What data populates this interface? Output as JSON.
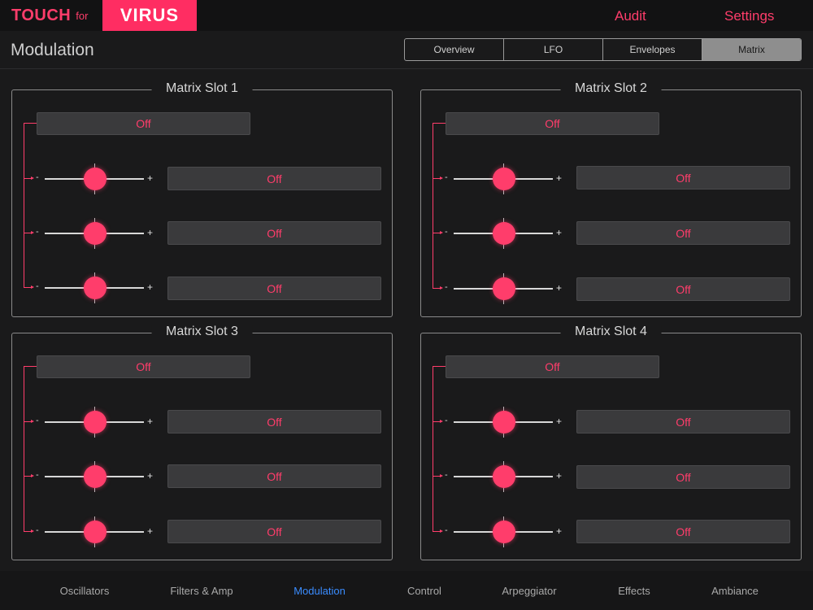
{
  "brand": {
    "touch": "TOUCH",
    "for": "for",
    "virus": "VIRUS"
  },
  "top_links": {
    "audit": "Audit",
    "settings": "Settings"
  },
  "header": {
    "title": "Modulation"
  },
  "tabs": [
    {
      "label": "Overview",
      "active": false
    },
    {
      "label": "LFO",
      "active": false
    },
    {
      "label": "Envelopes",
      "active": false
    },
    {
      "label": "Matrix",
      "active": true
    }
  ],
  "slots": [
    {
      "title": "Matrix Slot 1",
      "source": "Off",
      "rows": [
        {
          "minus": "-",
          "plus": "+",
          "destination": "Off"
        },
        {
          "minus": "-",
          "plus": "+",
          "destination": "Off"
        },
        {
          "minus": "-",
          "plus": "+",
          "destination": "Off"
        }
      ]
    },
    {
      "title": "Matrix Slot 2",
      "source": "Off",
      "rows": [
        {
          "minus": "-",
          "plus": "+",
          "destination": "Off"
        },
        {
          "minus": "-",
          "plus": "+",
          "destination": "Off"
        },
        {
          "minus": "-",
          "plus": "+",
          "destination": "Off"
        }
      ]
    },
    {
      "title": "Matrix Slot 3",
      "source": "Off",
      "rows": [
        {
          "minus": "-",
          "plus": "+",
          "destination": "Off"
        },
        {
          "minus": "-",
          "plus": "+",
          "destination": "Off"
        },
        {
          "minus": "-",
          "plus": "+",
          "destination": "Off"
        }
      ]
    },
    {
      "title": "Matrix Slot 4",
      "source": "Off",
      "rows": [
        {
          "minus": "-",
          "plus": "+",
          "destination": "Off"
        },
        {
          "minus": "-",
          "plus": "+",
          "destination": "Off"
        },
        {
          "minus": "-",
          "plus": "+",
          "destination": "Off"
        }
      ]
    }
  ],
  "bottom_nav": [
    {
      "label": "Oscillators",
      "active": false
    },
    {
      "label": "Filters & Amp",
      "active": false
    },
    {
      "label": "Modulation",
      "active": true
    },
    {
      "label": "Control",
      "active": false
    },
    {
      "label": "Arpeggiator",
      "active": false
    },
    {
      "label": "Effects",
      "active": false
    },
    {
      "label": "Ambiance",
      "active": false
    }
  ],
  "colors": {
    "accent": "#ff3d6b",
    "brand_block": "#ff2d62",
    "active_nav": "#3a8cff",
    "background": "#1a1a1b"
  }
}
